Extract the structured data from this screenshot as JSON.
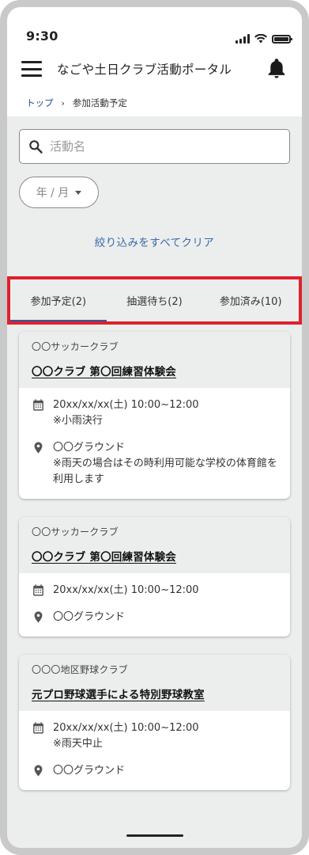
{
  "status": {
    "time": "9:30"
  },
  "appbar": {
    "title": "なごや土日クラブ活動ポータル"
  },
  "breadcrumb": {
    "home": "トップ",
    "current": "参加活動予定"
  },
  "filters": {
    "search_placeholder": "活動名",
    "month_placeholder": "年 / 月",
    "clear_label": "絞り込みをすべてクリア"
  },
  "tabs": [
    {
      "label": "参加予定(2)"
    },
    {
      "label": "抽選待ち(2)"
    },
    {
      "label": "参加済み(10)"
    }
  ],
  "cards": [
    {
      "club": "〇〇サッカークラブ",
      "title": "〇〇クラブ 第〇回練習体験会",
      "datetime": "20xx/xx/xx(土) 10:00~12:00",
      "datetime_note": "※小雨決行",
      "place": "〇〇グラウンド",
      "place_note": "※雨天の場合はその時利用可能な学校の体育館を利用します"
    },
    {
      "club": "〇〇サッカークラブ",
      "title": "〇〇クラブ 第〇回練習体験会",
      "datetime": "20xx/xx/xx(土) 10:00~12:00",
      "place": "〇〇グラウンド"
    },
    {
      "club": "〇〇〇地区野球クラブ",
      "title": "元プロ野球選手による特別野球教室",
      "datetime": "20xx/xx/xx(土) 10:00~12:00",
      "datetime_note": "※雨天中止",
      "place": "〇〇グラウンド"
    }
  ],
  "icons": {
    "menu": "menu-icon",
    "notification": "bell-icon",
    "search": "search-icon",
    "calendar": "calendar-icon",
    "location": "location-pin-icon"
  },
  "colors": {
    "link": "#1f4b8a",
    "clear_link": "#3a6aa8",
    "tab_indicator": "#2b5aa0",
    "highlight": "#e0202c",
    "panel_bg": "#eceeed"
  }
}
